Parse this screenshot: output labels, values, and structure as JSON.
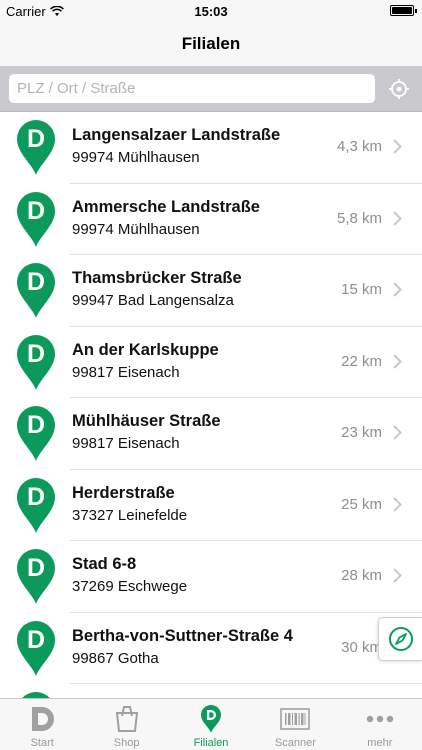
{
  "status_bar": {
    "carrier": "Carrier",
    "time": "15:03"
  },
  "nav": {
    "title": "Filialen"
  },
  "search": {
    "placeholder": "PLZ / Ort / Straße",
    "value": ""
  },
  "brand": {
    "accent": "#0b9a5c",
    "logo_letter": "D"
  },
  "stores": [
    {
      "street": "Langensalzaer Landstraße",
      "city": "99974 Mühlhausen",
      "distance": "4,3 km"
    },
    {
      "street": "Ammersche Landstraße",
      "city": "99974 Mühlhausen",
      "distance": "5,8 km"
    },
    {
      "street": "Thamsbrücker Straße",
      "city": "99947 Bad Langensalza",
      "distance": "15 km"
    },
    {
      "street": "An der Karlskuppe",
      "city": "99817 Eisenach",
      "distance": "22 km"
    },
    {
      "street": "Mühlhäuser Straße",
      "city": "99817 Eisenach",
      "distance": "23 km"
    },
    {
      "street": "Herderstraße",
      "city": "37327 Leinefelde",
      "distance": "25 km"
    },
    {
      "street": "Stad 6-8",
      "city": "37269 Eschwege",
      "distance": "28 km"
    },
    {
      "street": "Bertha-von-Suttner-Straße 4",
      "city": "99867 Gotha",
      "distance": "30 km"
    },
    {
      "street": "",
      "city": "",
      "distance": ""
    }
  ],
  "tabs": [
    {
      "label": "Start",
      "icon": "store-logo-icon",
      "active": false
    },
    {
      "label": "Shop",
      "icon": "shopping-bag-icon",
      "active": false
    },
    {
      "label": "Filialen",
      "icon": "location-pin-icon",
      "active": true
    },
    {
      "label": "Scanner",
      "icon": "barcode-icon",
      "active": false
    },
    {
      "label": "mehr",
      "icon": "more-dots-icon",
      "active": false
    }
  ]
}
